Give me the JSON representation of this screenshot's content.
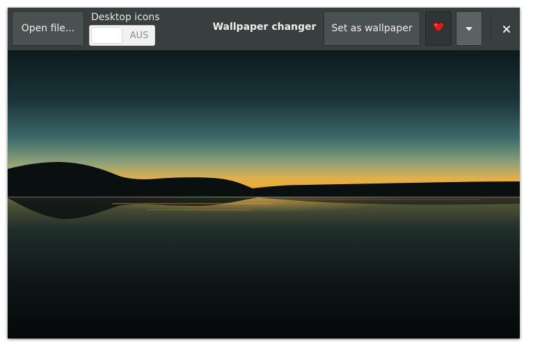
{
  "header": {
    "open_label": "Open file...",
    "desktop_icons_label": "Desktop icons",
    "desktop_icons_switch_state": "AUS",
    "title": "Wallpaper changer",
    "set_label": "Set as wallpaper",
    "favorite_icon": "heart-icon",
    "menu_icon": "chevron-down-icon",
    "close_icon": "close-icon"
  },
  "colors": {
    "headerbar": "#393f3f",
    "button": "#4a5151",
    "heart": "#d81e1e"
  }
}
